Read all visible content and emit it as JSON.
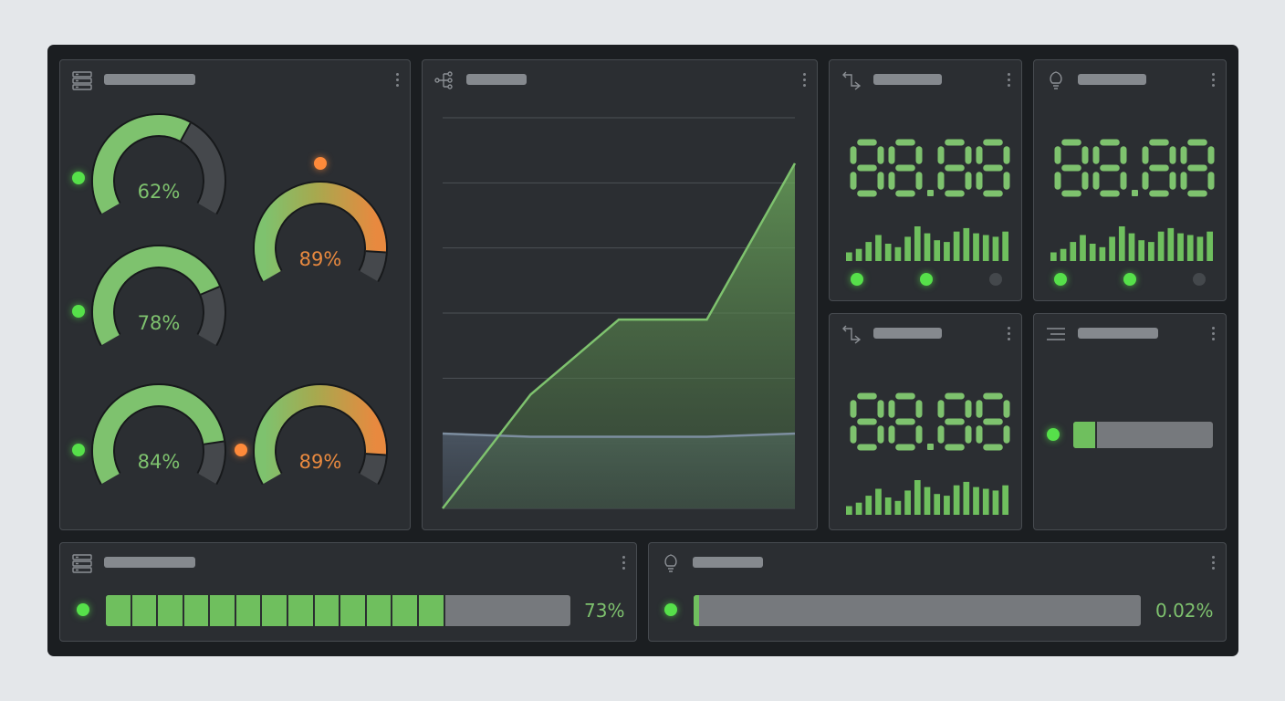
{
  "colors": {
    "accent": "#7ec26e",
    "warning": "#e8893f",
    "panel": "#2b2e32",
    "frame": "#1b1e21",
    "track": "#45484c",
    "bar_bg": "#76797d"
  },
  "gauges": [
    {
      "value": 62,
      "label": "62%",
      "status": "ok"
    },
    {
      "value": 78,
      "label": "78%",
      "status": "ok"
    },
    {
      "value": 84,
      "label": "84%",
      "status": "ok"
    },
    {
      "value": 89,
      "label": "89%",
      "status": "warning"
    },
    {
      "value": 89,
      "label": "89%",
      "status": "warning"
    }
  ],
  "icons": {
    "gauges_panel": "server-stack-icon",
    "chart_panel": "network-tree-icon",
    "digital_1": "route-arrows-icon",
    "digital_2": "lightbulb-icon",
    "digital_3": "route-arrows-icon",
    "level_panel": "list-lines-icon",
    "progress_left": "server-stack-icon",
    "progress_right": "lightbulb-icon"
  },
  "digital_displays": [
    {
      "readout": "88.88",
      "histogram": [
        0.25,
        0.35,
        0.55,
        0.75,
        0.5,
        0.4,
        0.7,
        1.0,
        0.8,
        0.6,
        0.55,
        0.85,
        0.95,
        0.8,
        0.75,
        0.7,
        0.85
      ]
    },
    {
      "readout": "88.88",
      "histogram": [
        0.25,
        0.35,
        0.55,
        0.75,
        0.5,
        0.4,
        0.7,
        1.0,
        0.8,
        0.6,
        0.55,
        0.85,
        0.95,
        0.8,
        0.75,
        0.7,
        0.85
      ]
    },
    {
      "readout": "88.88",
      "histogram": [
        0.25,
        0.35,
        0.55,
        0.75,
        0.5,
        0.4,
        0.7,
        1.0,
        0.8,
        0.6,
        0.55,
        0.85,
        0.95,
        0.8,
        0.75,
        0.7,
        0.85
      ]
    }
  ],
  "status_dots": {
    "digital_1": [
      "on",
      "on",
      "off"
    ],
    "digital_2": [
      "on",
      "on",
      "off"
    ]
  },
  "level_bar": {
    "fraction": 0.17
  },
  "progress_left": {
    "value": 73,
    "label": "73%",
    "segments": 13
  },
  "progress_right": {
    "value": 0.02,
    "label": "0.02%"
  },
  "chart_data": {
    "type": "area",
    "title": "",
    "xlabel": "",
    "ylabel": "",
    "x": [
      0,
      1,
      2,
      3,
      4
    ],
    "ylim": [
      0,
      6
    ],
    "grid": true,
    "series": [
      {
        "values": [
          0.0,
          1.75,
          2.9,
          2.9,
          5.3
        ],
        "color": "#7ec26e"
      },
      {
        "values": [
          1.15,
          1.1,
          1.1,
          1.1,
          1.15
        ],
        "color": "#7d8ea0"
      }
    ]
  }
}
